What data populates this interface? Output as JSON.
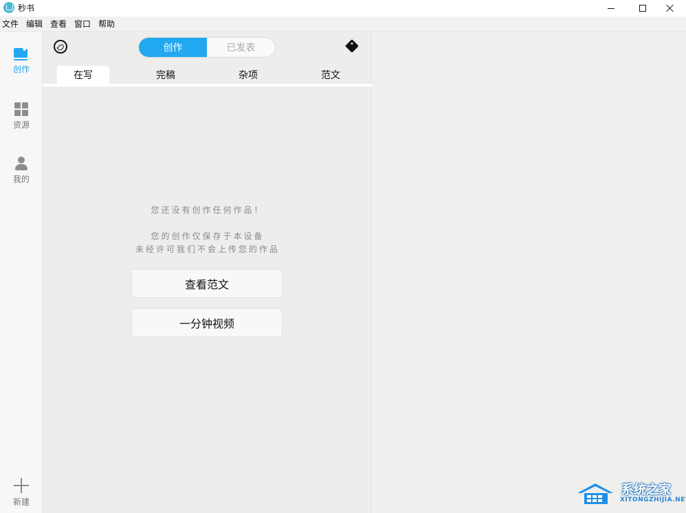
{
  "app": {
    "title": "秒书"
  },
  "menu": {
    "items": [
      "文件",
      "编辑",
      "查看",
      "窗口",
      "帮助"
    ]
  },
  "sidebar": {
    "items": [
      {
        "label": "创作",
        "icon": "edit-icon",
        "active": true
      },
      {
        "label": "资源",
        "icon": "grid-icon",
        "active": false
      },
      {
        "label": "我的",
        "icon": "user-icon",
        "active": false
      }
    ],
    "new_label": "新建"
  },
  "mode_toggle": {
    "create": "创作",
    "published": "已发表"
  },
  "tabs": [
    {
      "label": "在写",
      "active": true
    },
    {
      "label": "完稿",
      "active": false
    },
    {
      "label": "杂项",
      "active": false
    },
    {
      "label": "范文",
      "active": false
    }
  ],
  "empty_state": {
    "line1": "您还没有创作任何作品！",
    "line2": "您的创作仅保存于本设备",
    "line3": "未经许可我们不会上传您的作品"
  },
  "buttons": {
    "view_samples": "查看范文",
    "one_minute_video": "一分钟视频"
  },
  "watermark": {
    "title": "系统之家",
    "subtitle": "XITONGZHIJIA.NET"
  },
  "colors": {
    "accent": "#22a8f0",
    "panel_bg": "#eeedec"
  }
}
